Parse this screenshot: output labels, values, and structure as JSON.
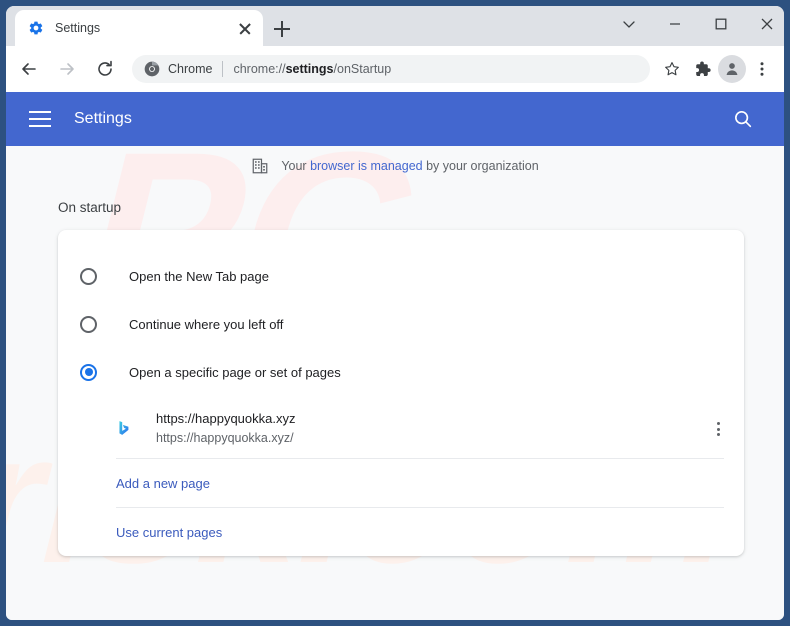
{
  "window": {
    "controls": {
      "tab_search_label": "tab-search",
      "minimize_label": "minimize",
      "maximize_label": "maximize",
      "close_label": "close"
    }
  },
  "tabstrip": {
    "tab": {
      "title": "Settings",
      "favicon": "gear-icon",
      "close_label": "Close tab"
    },
    "new_tab_label": "New tab"
  },
  "toolbar": {
    "back_label": "Back",
    "forward_label": "Forward",
    "reload_label": "Reload",
    "omnibox": {
      "badge_icon": "chrome-icon",
      "badge_text": "Chrome",
      "url_prefix": "chrome://",
      "url_bold": "settings",
      "url_suffix": "/onStartup",
      "url_full": "chrome://settings/onStartup"
    },
    "bookmark_label": "Bookmark this tab",
    "extensions_label": "Extensions",
    "profile_label": "Profile",
    "menu_label": "Customize and control Google Chrome"
  },
  "settings_header": {
    "menu_label": "Main menu",
    "title": "Settings",
    "search_label": "Search settings"
  },
  "managed_banner": {
    "icon": "building-icon",
    "text_before": "Your ",
    "link_text": "browser is managed",
    "text_after": " by your organization"
  },
  "on_startup": {
    "section_title": "On startup",
    "options": [
      {
        "label": "Open the New Tab page",
        "selected": false
      },
      {
        "label": "Continue where you left off",
        "selected": false
      },
      {
        "label": "Open a specific page or set of pages",
        "selected": true
      }
    ],
    "startup_pages": [
      {
        "favicon": "bing-icon",
        "title": "https://happyquokka.xyz",
        "url": "https://happyquokka.xyz/",
        "more_label": "More actions"
      }
    ],
    "add_page_label": "Add a new page",
    "use_current_label": "Use current pages"
  },
  "watermark": {
    "text_pc": "PC",
    "text_risk": "risk.com",
    "color_pc": "#fdeeee",
    "color_risk": "#eef1f7"
  },
  "colors": {
    "window_frame": "#2d5180",
    "tabstrip_bg": "#dee1e6",
    "toolbar_bg": "#ffffff",
    "settings_header_bg": "#4367cf",
    "page_bg": "#f8f9fa",
    "card_bg": "#ffffff",
    "accent_blue": "#1a73e8",
    "link_blue": "#3b5bbd",
    "text_primary": "#202124",
    "text_secondary": "#5f6368"
  }
}
